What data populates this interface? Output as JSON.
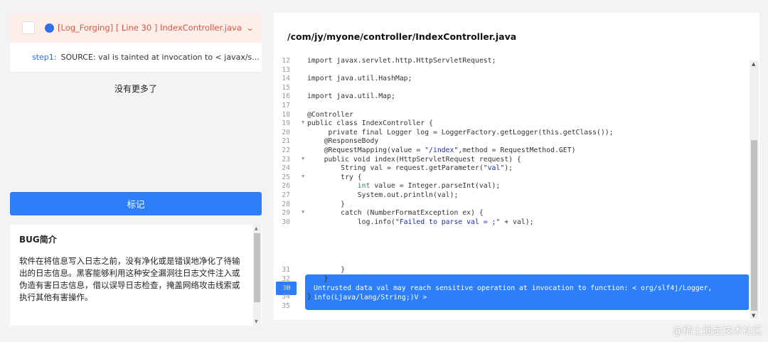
{
  "issue": {
    "title": "[Log_Forging] [ Line 30 ] IndexController.java",
    "step_label": "step1:",
    "step_text": "SOURCE: val is tainted at invocation to < javax/s..."
  },
  "no_more": "没有更多了",
  "mark_button": "标记",
  "bug": {
    "title": "BUG简介",
    "desc": "软件在将信息写入日志之前，没有净化或是错误地净化了待输出的日志信息。黑客能够利用这种安全漏洞往日志文件注入或伪造有害日志信息，借以误导日志检查，掩盖网络攻击线索或执行其他有害操作。"
  },
  "file_path": "/com/jy/myone/controller/IndexController.java",
  "code_lines": [
    {
      "n": "12",
      "t": "import javax.servlet.http.HttpServletRequest;",
      "fold": ""
    },
    {
      "n": "13",
      "t": "",
      "fold": ""
    },
    {
      "n": "14",
      "t": "import java.util.HashMap;",
      "fold": ""
    },
    {
      "n": "15",
      "t": "",
      "fold": ""
    },
    {
      "n": "16",
      "t": "import java.util.Map;",
      "fold": ""
    },
    {
      "n": "17",
      "t": "",
      "fold": ""
    },
    {
      "n": "18",
      "t": "@Controller",
      "fold": ""
    },
    {
      "n": "19",
      "t": "public class IndexController {",
      "fold": "▼"
    },
    {
      "n": "20",
      "t": "     private final Logger log = LoggerFactory.getLogger(this.getClass());",
      "fold": ""
    },
    {
      "n": "21",
      "t": "    @ResponseBody",
      "fold": ""
    },
    {
      "n": "22",
      "t": "    @RequestMapping(value = \"/index\",method = RequestMethod.GET)",
      "fold": ""
    },
    {
      "n": "23",
      "t": "    public void index(HttpServletRequest request) {",
      "fold": "▼"
    },
    {
      "n": "24",
      "t": "        String val = request.getParameter(\"val\");",
      "fold": ""
    },
    {
      "n": "25",
      "t": "        try {",
      "fold": "▼"
    },
    {
      "n": "26",
      "t": "            int value = Integer.parseInt(val);",
      "fold": ""
    },
    {
      "n": "27",
      "t": "            System.out.println(val);",
      "fold": ""
    },
    {
      "n": "28",
      "t": "        }",
      "fold": ""
    },
    {
      "n": "29",
      "t": "        catch (NumberFormatException ex) {",
      "fold": "▼"
    },
    {
      "n": "30",
      "t": "            log.info(\"Failed to parse val = ;\" + val);",
      "fold": ""
    },
    {
      "n": "31",
      "t": "        }",
      "fold": ""
    },
    {
      "n": "32",
      "t": "    }",
      "fold": ""
    },
    {
      "n": "33",
      "t": "",
      "fold": ""
    },
    {
      "n": "34",
      "t": "}",
      "fold": ""
    },
    {
      "n": "35",
      "t": "",
      "fold": ""
    }
  ],
  "highlight": {
    "line": "30",
    "message": "Untrusted data val may reach sensitive operation at invocation to function: < org/slf4j/Logger, info(Ljava/lang/String;)V >"
  },
  "watermark": "@稀土掘金技术社区"
}
